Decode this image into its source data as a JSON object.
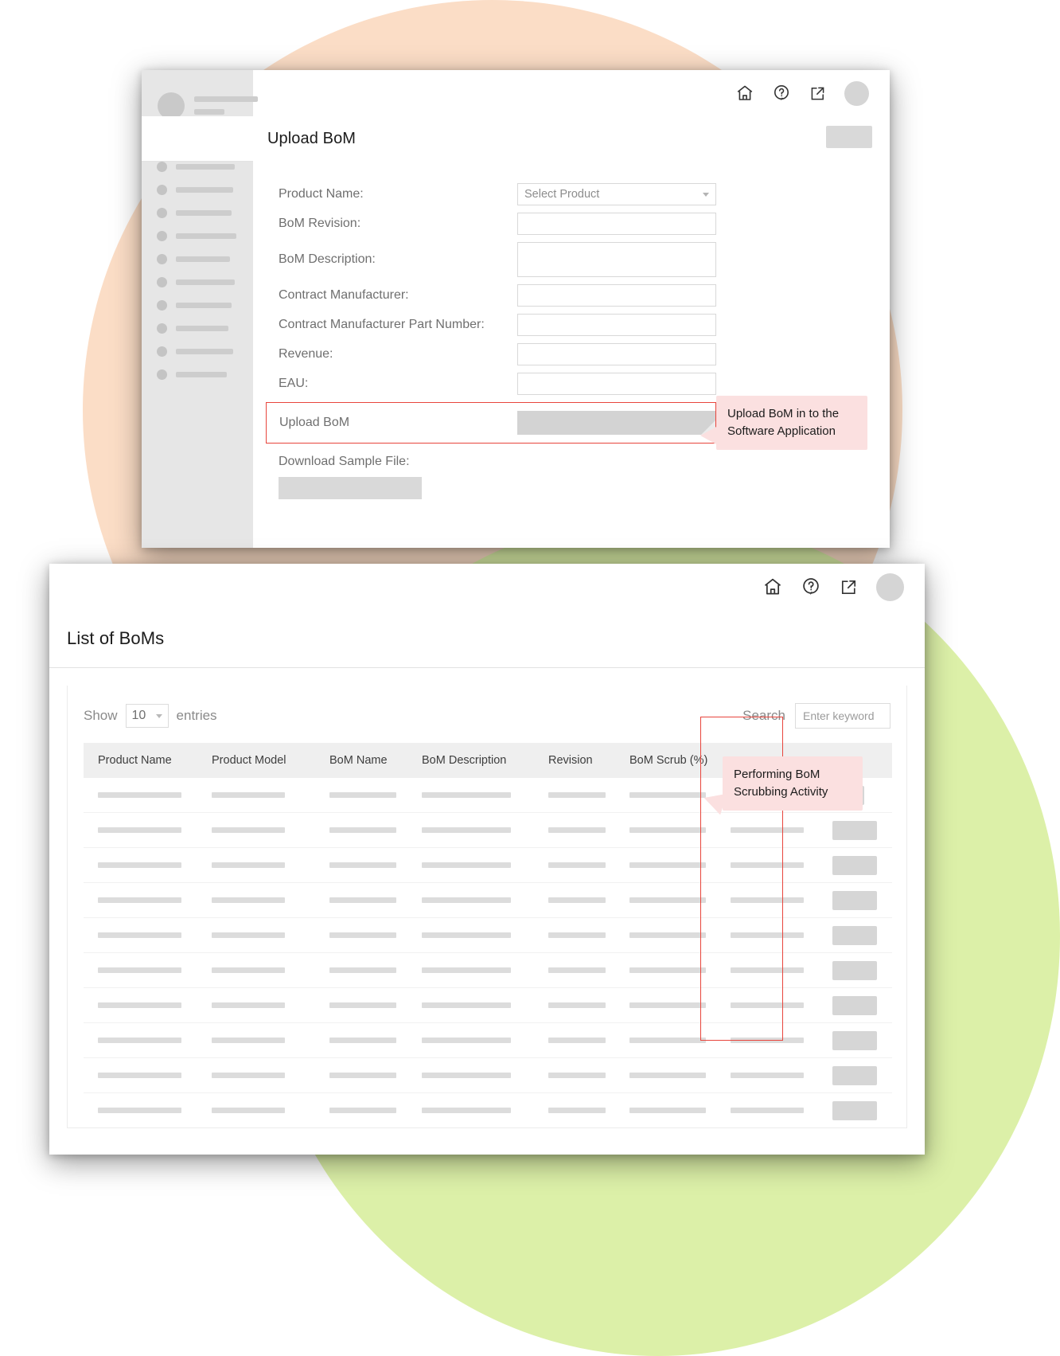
{
  "theme": {
    "peach_blob": "#fbddc6",
    "green_blob": "#dcf0a8",
    "highlight_red": "#e8453c",
    "callout_bg": "#fbe0e0",
    "skeleton_grey": "#dcdcdc"
  },
  "upload_window": {
    "topbar": {
      "icons": [
        "home-icon",
        "help-icon",
        "external-link-icon"
      ],
      "avatar": "user-avatar"
    },
    "page_title": "Upload BoM",
    "sidebar": {
      "profile_name_placeholder": "",
      "item_count": 10
    },
    "form": {
      "rows": [
        {
          "label": "Product Name:",
          "value": "Select Product",
          "type": "select"
        },
        {
          "label": "BoM Revision:",
          "value": "",
          "type": "text"
        },
        {
          "label": "BoM Description:",
          "value": "",
          "type": "textarea"
        },
        {
          "label": "Contract Manufacturer:",
          "value": "",
          "type": "text"
        },
        {
          "label": "Contract Manufacturer Part Number:",
          "value": "",
          "type": "text"
        },
        {
          "label": "Revenue:",
          "value": "",
          "type": "text"
        },
        {
          "label": "EAU:",
          "value": "",
          "type": "text"
        }
      ],
      "upload_row_label": "Upload BoM",
      "download_sample_label": "Download Sample File:"
    },
    "callout": "Upload BoM in to the Software Application"
  },
  "list_window": {
    "topbar": {
      "icons": [
        "home-icon",
        "help-icon",
        "external-link-icon"
      ],
      "avatar": "user-avatar"
    },
    "page_title": "List of BoMs",
    "controls": {
      "show_label": "Show",
      "entries_value": "10",
      "entries_label": "entries",
      "search_label": "Search",
      "search_placeholder": "Enter keyword",
      "search_value": ""
    },
    "table": {
      "columns": [
        "Product Name",
        "Product Model",
        "BoM Name",
        "BoM Description",
        "Revision",
        "BoM Scrub (%)",
        "",
        ""
      ],
      "row_count": 10,
      "highlighted_column": "BoM Scrub (%)"
    },
    "callout": "Performing BoM Scrubbing Activity"
  }
}
